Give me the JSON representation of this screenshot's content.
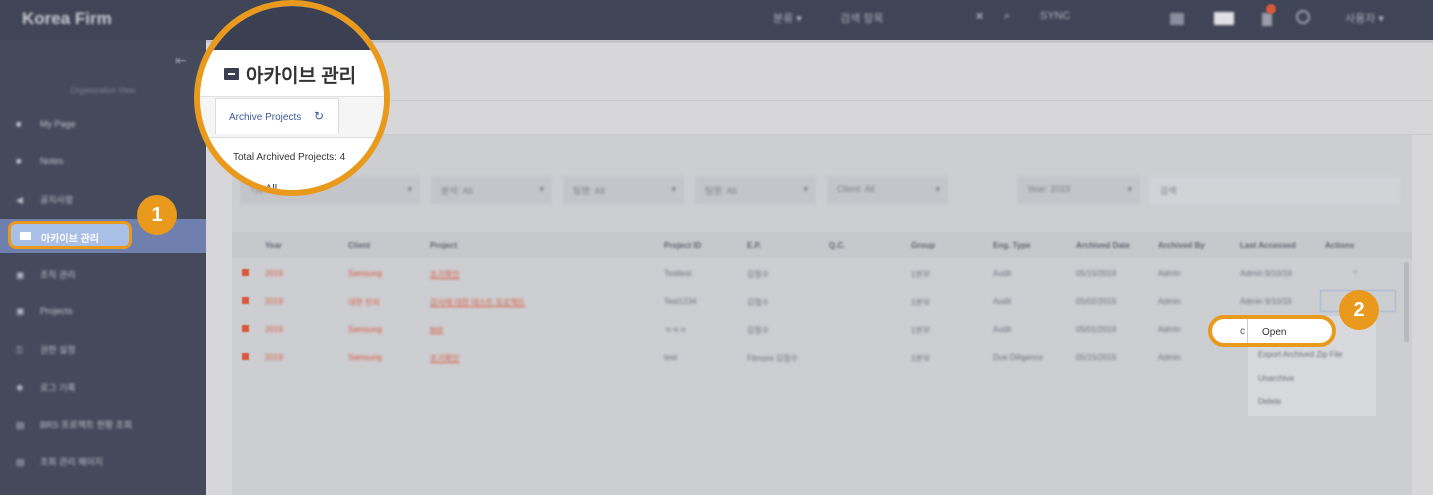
{
  "topbar": {
    "brand": "Korea Firm",
    "items": [
      "분류 ▾",
      "검색 항목",
      "✕",
      "SYNC",
      "사용자 ▾"
    ]
  },
  "sidebar": {
    "org_label": "Organization View",
    "items": [
      {
        "label": "My Page"
      },
      {
        "label": "Notes"
      },
      {
        "label": "공지사항"
      },
      {
        "label": "아카이브 관리"
      },
      {
        "label": "조직 관리"
      },
      {
        "label": "Projects"
      },
      {
        "label": "권한 설정"
      },
      {
        "label": "로그 기록"
      },
      {
        "label": "BRS 프로젝트 현황 조회"
      },
      {
        "label": "조회 관리 페이지"
      }
    ]
  },
  "zoom": {
    "title": "아카이브 관리",
    "tab_label": "Archive Projects",
    "refresh_glyph": "↻",
    "total_label": "Total Archived Projects: 4",
    "type_label": "Type:",
    "type_value": "All"
  },
  "filters": [
    {
      "label": "Type: All"
    },
    {
      "label": "분석: All"
    },
    {
      "label": "팀명: All"
    },
    {
      "label": "팀명: All"
    },
    {
      "label": "Client: All"
    },
    {
      "label": "Year: 2019"
    },
    {
      "label": "검색"
    }
  ],
  "table": {
    "headers": [
      "Year",
      "Client",
      "Project",
      "Project ID",
      "E.P.",
      "Q.C.",
      "Group",
      "Eng. Type",
      "Archived Date",
      "Archived By",
      "Last Accessed",
      "Actions"
    ],
    "rows": [
      {
        "year": "2019",
        "client": "Samsung",
        "project": "조기확인",
        "pid": "Testtest",
        "ep": "김철수",
        "group": "1본부",
        "etype": "Audit",
        "adate": "05/15/2019",
        "aby": "Admin",
        "last": "Admin 9/10/19"
      },
      {
        "year": "2019",
        "client": "대한 전자",
        "project": "감사에 대한 테스트 프로젝트",
        "pid": "Test1234",
        "ep": "김철수",
        "group": "1본부",
        "etype": "Audit",
        "adate": "05/02/2019",
        "aby": "Admin",
        "last": "Admin 9/10/19"
      },
      {
        "year": "2019",
        "client": "Samsung",
        "project": "test",
        "pid": "ㅋㅋㅋ",
        "ep": "김철수",
        "group": "1본부",
        "etype": "Audit",
        "adate": "05/01/2019",
        "aby": "Admin",
        "last": "Admin 9/10/19"
      },
      {
        "year": "2019",
        "client": "Samsung",
        "project": "조기확인",
        "pid": "test",
        "ep": "Filmore 김철수",
        "group": "1본부",
        "etype": "Due Diligence",
        "adate": "05/15/2019",
        "aby": "Admin",
        "last": ""
      }
    ]
  },
  "actions_menu": {
    "open": "Open",
    "c_glyph": "c",
    "items": [
      "Export Archived Zip File",
      "Unarchive",
      "Delete"
    ]
  },
  "callouts": {
    "one": "1",
    "two": "2"
  },
  "colors": {
    "accent": "#e99a1c",
    "sidebar": "#444a5c",
    "link": "#d9583c",
    "tab_text": "#3d5a98"
  }
}
